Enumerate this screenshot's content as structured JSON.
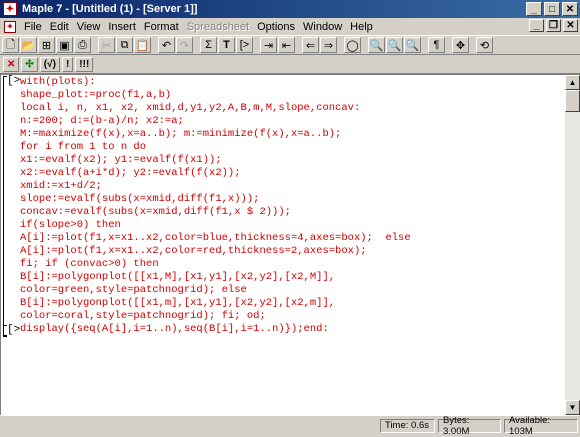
{
  "window": {
    "title": "Maple 7 - [Untitled (1) - [Server 1]]",
    "app_icon": "maple-leaf-icon"
  },
  "menubar": {
    "items": [
      {
        "label": "File",
        "enabled": true
      },
      {
        "label": "Edit",
        "enabled": true
      },
      {
        "label": "View",
        "enabled": true
      },
      {
        "label": "Insert",
        "enabled": true
      },
      {
        "label": "Format",
        "enabled": true
      },
      {
        "label": "Spreadsheet",
        "enabled": false
      },
      {
        "label": "Options",
        "enabled": true
      },
      {
        "label": "Window",
        "enabled": true
      },
      {
        "label": "Help",
        "enabled": true
      }
    ]
  },
  "toolbar2": {
    "buttons": [
      "✕",
      "✣",
      "(√)",
      "!",
      "!!!"
    ]
  },
  "document": {
    "prompt": "[>",
    "code_lines": [
      "with(plots):",
      "shape_plot:=proc(f1,a,b)",
      "local i, n, x1, x2, xmid,d,y1,y2,A,B,m,M,slope,concav:",
      "n:=200; d:=(b-a)/n; x2:=a;",
      "M:=maximize(f(x),x=a..b); m:=minimize(f(x),x=a..b);",
      "for i from 1 to n do",
      "x1:=evalf(x2); y1:=evalf(f(x1));",
      "x2:=evalf(a+i*d); y2:=evalf(f(x2));",
      "xmid:=x1+d/2;",
      "slope:=evalf(subs(x=xmid,diff(f1,x)));",
      "concav:=evalf(subs(x=xmid,diff(f1,x $ 2)));",
      "if(slope>0) then",
      "A[i]:=plot(f1,x=x1..x2,color=blue,thickness=4,axes=box);  else",
      "A[i]:=plot(f1,x=x1..x2,color=red,thickness=2,axes=box);",
      "fi; if (convac>0) then",
      "B[i]:=polygonplot([[x1,M],[x1,y1],[x2,y2],[x2,M]],",
      "color=green,style=patchnogrid); else",
      "B[i]:=polygonplot([[x1,m],[x1,y1],[x2,y2],[x2,m]],",
      "color=coral,style=patchnogrid); fi; od;",
      "display({seq(A[i],i=1..n),seq(B[i],i=1..n)});end:"
    ],
    "empty_prompt": "[>"
  },
  "status": {
    "time": "Time:  0.6s",
    "bytes": "Bytes: 3.00M",
    "available": "Available: 103M"
  }
}
